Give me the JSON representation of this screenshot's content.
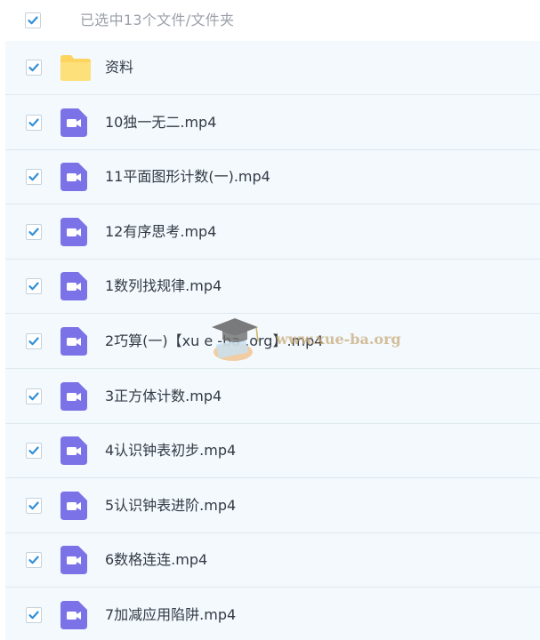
{
  "header": {
    "selection_label": "已选中13个文件/文件夹",
    "checked": true
  },
  "colors": {
    "accent": "#2f8fd8",
    "video_icon": "#7b72e8",
    "folder_icon": "#fcd45e",
    "list_background": "#f3f9fd"
  },
  "items": [
    {
      "name": "资料",
      "type": "folder",
      "icon": "folder-icon",
      "checked": true
    },
    {
      "name": "10独一无二.mp4",
      "type": "video",
      "icon": "video-file-icon",
      "checked": true
    },
    {
      "name": "11平面图形计数(一).mp4",
      "type": "video",
      "icon": "video-file-icon",
      "checked": true
    },
    {
      "name": "12有序思考.mp4",
      "type": "video",
      "icon": "video-file-icon",
      "checked": true
    },
    {
      "name": "1数列找规律.mp4",
      "type": "video",
      "icon": "video-file-icon",
      "checked": true
    },
    {
      "name": "2巧算(一)【xu e -ba .org】.mp4",
      "type": "video",
      "icon": "video-file-icon",
      "checked": true
    },
    {
      "name": "3正方体计数.mp4",
      "type": "video",
      "icon": "video-file-icon",
      "checked": true
    },
    {
      "name": "4认识钟表初步.mp4",
      "type": "video",
      "icon": "video-file-icon",
      "checked": true
    },
    {
      "name": "5认识钟表进阶.mp4",
      "type": "video",
      "icon": "video-file-icon",
      "checked": true
    },
    {
      "name": "6数格连连.mp4",
      "type": "video",
      "icon": "video-file-icon",
      "checked": true
    },
    {
      "name": "7加减应用陷阱.mp4",
      "type": "video",
      "icon": "video-file-icon",
      "checked": true
    }
  ],
  "watermark": {
    "text": "www.xue-ba.org",
    "icon": "graduation-cap-icon"
  }
}
